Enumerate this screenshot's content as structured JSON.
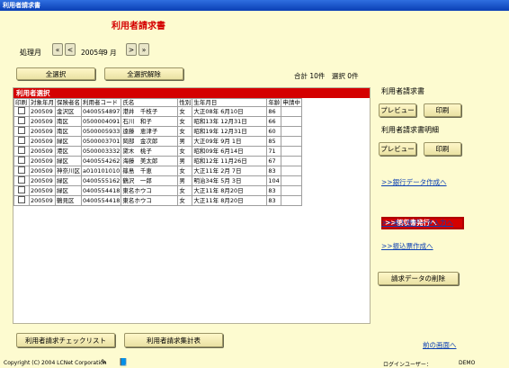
{
  "window": {
    "title": "利用者請求書"
  },
  "heading": "利用者請求書",
  "period": {
    "label": "処理月",
    "prev_double": "«",
    "prev": "<",
    "year_value": "2005年",
    "month_value": "9 月",
    "next": ">",
    "next_double": "»"
  },
  "selection": {
    "select_all": "全選択",
    "deselect_all": "全選択解除",
    "summary": "合計 10件　選択 0件"
  },
  "table": {
    "title": "利用者選択",
    "columns": [
      "印刷",
      "対象年月",
      "保険者名",
      "利用者コード",
      "氏名",
      "性別",
      "生年月日",
      "年齢",
      "申請中"
    ],
    "rows": [
      [
        "200509",
        "金沢区",
        "0400554897",
        "港井　千枝子",
        "女",
        "大正08年 6月10日",
        "86",
        ""
      ],
      [
        "200509",
        "南区",
        "0500004091",
        "石川　和子",
        "女",
        "昭和13年 12月31日",
        "66",
        ""
      ],
      [
        "200509",
        "南区",
        "0500005933",
        "遠藤　恵津子",
        "女",
        "昭和19年 12月31日",
        "60",
        ""
      ],
      [
        "200509",
        "緑区",
        "0500003701",
        "岡部　金次郎",
        "男",
        "大正09年 9月 1日",
        "85",
        ""
      ],
      [
        "200509",
        "港区",
        "0500003332",
        "黛木　桃子",
        "女",
        "昭和09年 6月14日",
        "71",
        ""
      ],
      [
        "200509",
        "緑区",
        "0400554262",
        "海藤　美太郎",
        "男",
        "昭和12年 11月26日",
        "67",
        ""
      ],
      [
        "200509",
        "神奈川区",
        "a010101010",
        "篠島　千恵",
        "女",
        "大正11年 2月 7日",
        "83",
        ""
      ],
      [
        "200509",
        "緑区",
        "0400555162",
        "鶴沢　一郎",
        "男",
        "明治34年 5月 3日",
        "104",
        ""
      ],
      [
        "200509",
        "緑区",
        "0400554418",
        "東名ホウコ",
        "女",
        "大正11年 8月20日",
        "83",
        ""
      ],
      [
        "200509",
        "鶴見区",
        "0400554418",
        "東名ホウコ",
        "女",
        "大正11年 8月20日",
        "83",
        ""
      ]
    ]
  },
  "right_panel": {
    "invoice_label": "利用者請求書",
    "detail_label": "利用者請求書明細",
    "preview": "プレビュー",
    "print": "印刷",
    "link_bank": ">>銀行データ作成へ",
    "link_receipt": ">>領収書発行へ",
    "link_unpaid": ">>未入金データ入力へ",
    "link_transfer": ">>振込票作成へ",
    "delete_button": "請求データの削除"
  },
  "bottom": {
    "checklist": "利用者請求チェックリスト",
    "summary_table": "利用者請求集計表",
    "back_link": "前の画面へ"
  },
  "footer": {
    "copyright": "Copyright (C) 2004 LCNet Corporation",
    "login_label": "ログインユーザー：",
    "login_user": "DEMO"
  }
}
